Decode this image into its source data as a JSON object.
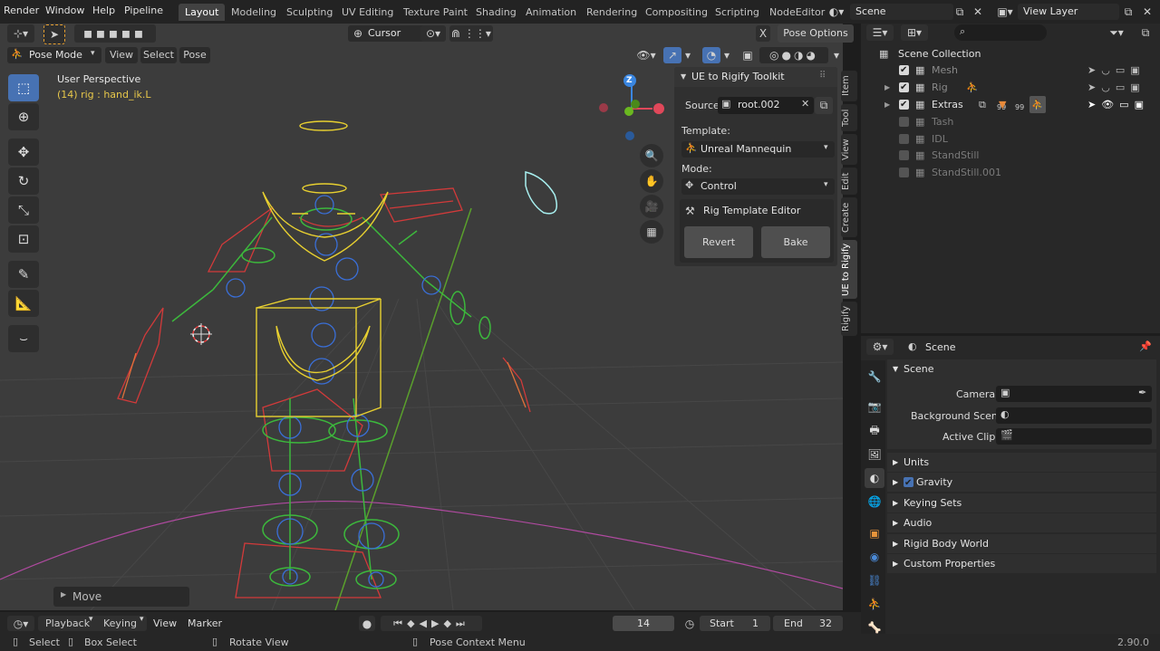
{
  "menubar": {
    "menus": [
      "Render",
      "Window",
      "Help",
      "Pipeline"
    ],
    "workspaces": [
      "Layout",
      "Modeling",
      "Sculpting",
      "UV Editing",
      "Texture Paint",
      "Shading",
      "Animation",
      "Rendering",
      "Compositing",
      "Scripting",
      "NodeEditor"
    ],
    "active_workspace": "Layout",
    "scene_name": "Scene",
    "view_layer": "View Layer"
  },
  "viewport_header": {
    "mode": "Pose Mode",
    "menus": [
      "View",
      "Select",
      "Pose"
    ],
    "transform_pivot": "Cursor",
    "pose_options": "Pose Options"
  },
  "viewport": {
    "perspective": "User Perspective",
    "selection_info": "(14) rig : hand_ik.L",
    "last_operator": "Move",
    "nav_gizmo": {
      "z": "Z"
    }
  },
  "side_tabs": [
    "Item",
    "Tool",
    "View",
    "Edit",
    "Create",
    "UE to Rigify",
    "Rigify"
  ],
  "active_side_tab": "UE to Rigify",
  "npanel": {
    "title": "UE to Rigify Toolkit",
    "source_label": "Source:",
    "source_value": "root.002",
    "template_label": "Template:",
    "template_value": "Unreal Mannequin",
    "mode_label": "Mode:",
    "mode_value": "Control",
    "subpanel_title": "Rig Template Editor",
    "revert_label": "Revert",
    "bake_label": "Bake"
  },
  "outliner": {
    "root": "Scene Collection",
    "items": [
      {
        "name": "Mesh",
        "checked": true,
        "dim": true,
        "expand": false
      },
      {
        "name": "Rig",
        "checked": true,
        "dim": true,
        "expand": true
      },
      {
        "name": "Extras",
        "checked": true,
        "dim": false,
        "expand": true,
        "badge1": "99",
        "badge2": "99"
      },
      {
        "name": "Tash",
        "checked": false,
        "dim": true,
        "expand": false
      },
      {
        "name": "IDL",
        "checked": false,
        "dim": true,
        "expand": false
      },
      {
        "name": "StandStill",
        "checked": false,
        "dim": true,
        "expand": false
      },
      {
        "name": "StandStill.001",
        "checked": false,
        "dim": true,
        "expand": false
      }
    ]
  },
  "properties": {
    "context_title": "Scene",
    "panel_title": "Scene",
    "camera_label": "Camera",
    "background_scene_label": "Background Scene",
    "active_clip_label": "Active Clip",
    "collapsed_panels": [
      "Units",
      "Gravity",
      "Keying Sets",
      "Audio",
      "Rigid Body World",
      "Custom Properties"
    ],
    "gravity_enabled": true
  },
  "timeline": {
    "menus": [
      "Playback",
      "Keying",
      "View",
      "Marker"
    ],
    "current_frame": "14",
    "start_label": "Start",
    "start_value": "1",
    "end_label": "End",
    "end_value": "32"
  },
  "statusbar": {
    "select": "Select",
    "box_select": "Box Select",
    "rotate_view": "Rotate View",
    "context_menu": "Pose Context Menu",
    "version": "2.90.0"
  },
  "colors": {
    "accent": "#4772b3",
    "bone_red": "#d23a3a",
    "bone_yellow": "#e8d030",
    "bone_green": "#3cb83c",
    "bone_blue": "#3a6fd8",
    "axis_x": "#e0485a",
    "axis_y": "#6ab820",
    "axis_z": "#3a86e0"
  }
}
